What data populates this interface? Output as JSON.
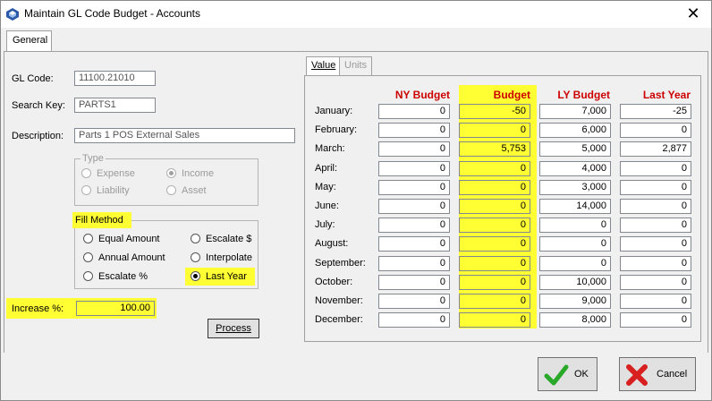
{
  "window": {
    "title": "Maintain GL Code Budget - Accounts",
    "close_glyph": "✕"
  },
  "tabs": {
    "general": "General"
  },
  "form": {
    "gl_code_label": "GL Code:",
    "gl_code_value": "11100.21010",
    "search_key_label": "Search Key:",
    "search_key_value": "PARTS1",
    "description_label": "Description:",
    "description_value": "Parts 1 POS External Sales"
  },
  "type_group": {
    "title": "Type",
    "expense": "Expense",
    "income": "Income",
    "liability": "Liability",
    "asset": "Asset",
    "selected": "Income"
  },
  "fill_method": {
    "title": "Fill Method",
    "equal_amount": "Equal Amount",
    "escalate_dollar": "Escalate $",
    "annual_amount": "Annual Amount",
    "interpolate": "Interpolate",
    "escalate_pct": "Escalate %",
    "last_year": "Last Year",
    "selected": "Last Year"
  },
  "increase": {
    "label": "Increase %:",
    "value": "100.00"
  },
  "process_button": "Process",
  "value_tabs": {
    "value": "Value",
    "units": "Units"
  },
  "columns": {
    "ny_budget": "NY Budget",
    "budget": "Budget",
    "ly_budget": "LY Budget",
    "last_year": "Last Year"
  },
  "months": [
    {
      "name": "January:",
      "ny": "0",
      "budget": "-50",
      "ly": "7,000",
      "last": "-25"
    },
    {
      "name": "February:",
      "ny": "0",
      "budget": "0",
      "ly": "6,000",
      "last": "0"
    },
    {
      "name": "March:",
      "ny": "0",
      "budget": "5,753",
      "ly": "5,000",
      "last": "2,877"
    },
    {
      "name": "April:",
      "ny": "0",
      "budget": "0",
      "ly": "4,000",
      "last": "0"
    },
    {
      "name": "May:",
      "ny": "0",
      "budget": "0",
      "ly": "3,000",
      "last": "0"
    },
    {
      "name": "June:",
      "ny": "0",
      "budget": "0",
      "ly": "14,000",
      "last": "0"
    },
    {
      "name": "July:",
      "ny": "0",
      "budget": "0",
      "ly": "0",
      "last": "0"
    },
    {
      "name": "August:",
      "ny": "0",
      "budget": "0",
      "ly": "0",
      "last": "0"
    },
    {
      "name": "September:",
      "ny": "0",
      "budget": "0",
      "ly": "0",
      "last": "0"
    },
    {
      "name": "October:",
      "ny": "0",
      "budget": "0",
      "ly": "10,000",
      "last": "0"
    },
    {
      "name": "November:",
      "ny": "0",
      "budget": "0",
      "ly": "9,000",
      "last": "0"
    },
    {
      "name": "December:",
      "ny": "0",
      "budget": "0",
      "ly": "8,000",
      "last": "0"
    }
  ],
  "buttons": {
    "ok": "OK",
    "cancel": "Cancel"
  },
  "colors": {
    "highlight": "#ffff33",
    "header_red": "#cc0000"
  }
}
